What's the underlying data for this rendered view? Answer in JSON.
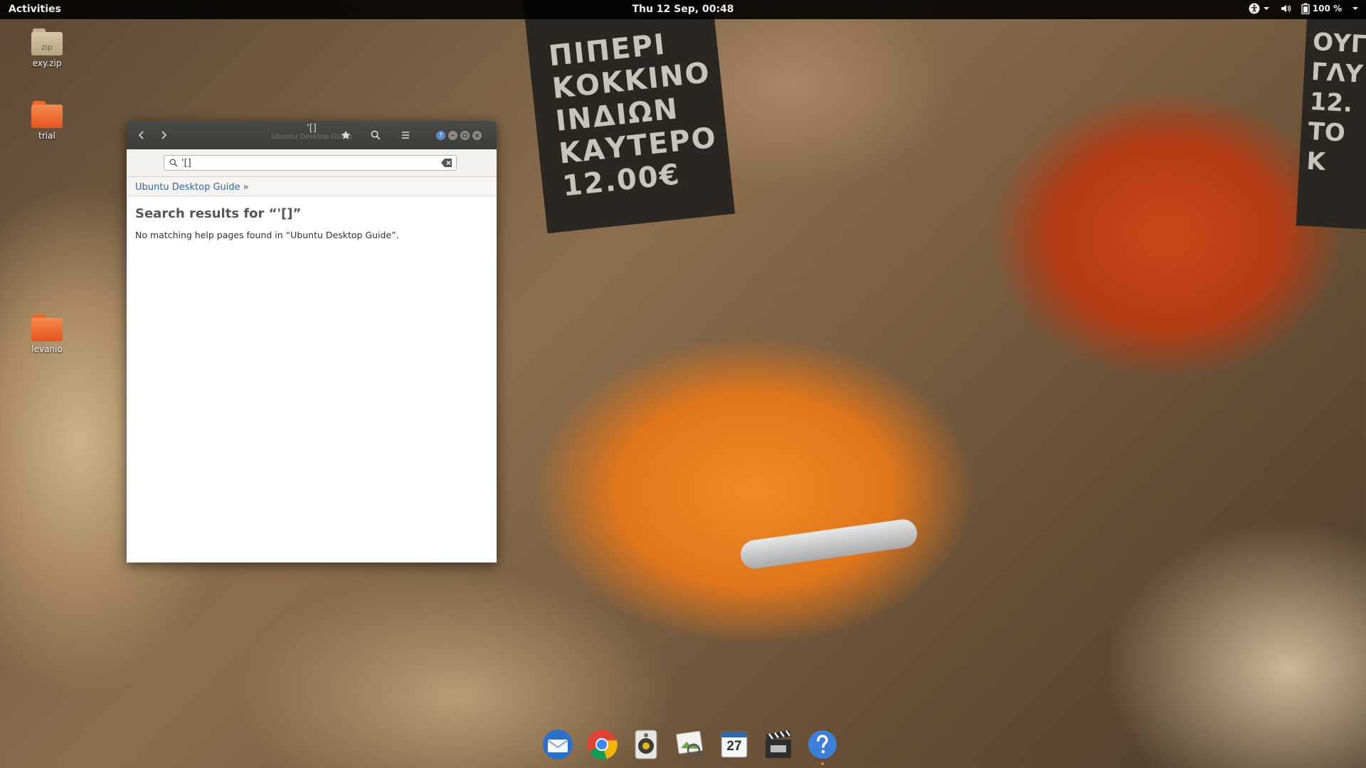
{
  "topbar": {
    "activities": "Activities",
    "clock": "Thu 12 Sep, 00:48",
    "battery": "100 %"
  },
  "wallpaper": {
    "sign_lines": [
      "ΠΙΠΕΡΙ",
      "ΚΟΚΚΙΝΟ",
      "ΙΝΔΙΩΝ",
      "ΚΑΥΤΕΡΟ",
      "12.00€"
    ],
    "sign2_lines": [
      "ΟΥΓΓ",
      "ΓΛΥ",
      "12.",
      "ΤΟ Κ"
    ]
  },
  "desktop": {
    "icons": [
      {
        "label": "exy.zip",
        "badge": "zip",
        "kind": "zip"
      },
      {
        "label": "trial",
        "kind": "folder"
      },
      {
        "label": "levanio",
        "kind": "folder"
      }
    ]
  },
  "help_window": {
    "title": "'[]",
    "subtitle": "Ubuntu Desktop Guide",
    "search_value": "'[]",
    "breadcrumb": "Ubuntu Desktop Guide",
    "breadcrumb_sep": "»",
    "heading": "Search results for “'[]”",
    "message": "No matching help pages found in “Ubuntu Desktop Guide”."
  },
  "dock": {
    "items": [
      "thunderbird",
      "chrome",
      "rhythmbox",
      "image-viewer",
      "calendar",
      "videos",
      "help"
    ],
    "calendar_day": "27"
  },
  "colors": {
    "accent": "#e95420",
    "link": "#3465a4",
    "headerbar": "#3c3b37",
    "topbar": "#000000"
  }
}
